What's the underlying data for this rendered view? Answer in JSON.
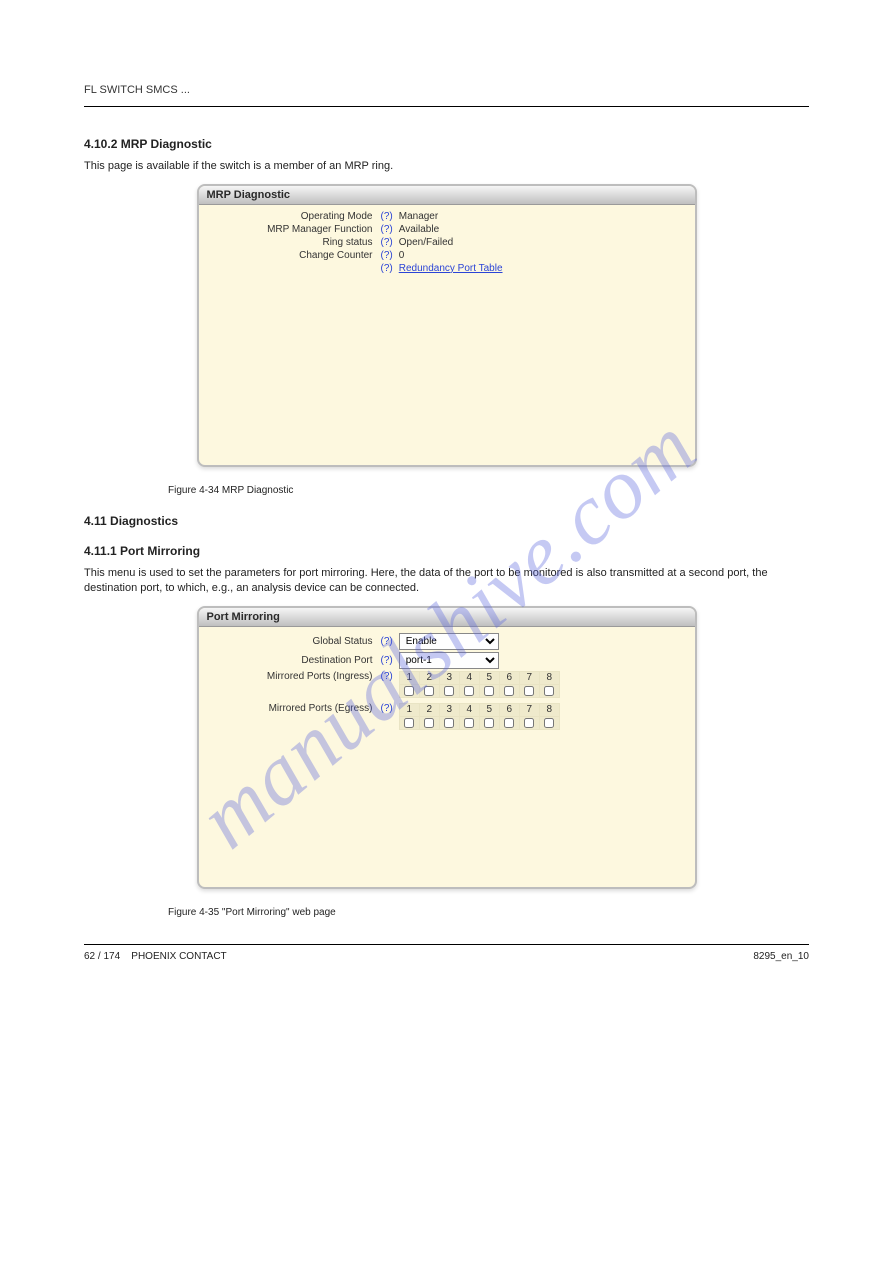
{
  "running_head": "FL SWITCH SMCS ...",
  "watermark": "manualshive.com",
  "section1": {
    "head": "4.10.2       MRP Diagnostic",
    "intro": "This page is available if the switch is a member of an MRP ring.",
    "panel_title": "MRP Diagnostic",
    "rows": {
      "op_mode_label": "Operating Mode",
      "op_mode_value": "Manager",
      "mgr_fn_label": "MRP Manager Function",
      "mgr_fn_value": "Available",
      "ring_label": "Ring status",
      "ring_value": "Open/Failed",
      "counter_label": "Change Counter",
      "counter_value": "0",
      "link_text": "Redundancy Port Table"
    },
    "help_marker": "(?)",
    "figcap": "Figure 4-34    MRP Diagnostic"
  },
  "section2": {
    "head": "4.11         Diagnostics",
    "sub_head": "4.11.1       Port Mirroring",
    "intro": "This menu is used to set the parameters for port mirroring. Here, the data of the port to be monitored is also transmitted at a second port, the destination port, to which, e.g., an analysis device can be connected.",
    "panel_title": "Port Mirroring",
    "rows": {
      "global_label": "Global Status",
      "global_value": "Enable",
      "dest_label": "Destination Port",
      "dest_value": "port-1",
      "ingress_label": "Mirrored Ports (Ingress)",
      "egress_label": "Mirrored Ports (Egress)"
    },
    "help_marker": "(?)",
    "ports": [
      "1",
      "2",
      "3",
      "4",
      "5",
      "6",
      "7",
      "8"
    ],
    "figcap": "Figure 4-35    \"Port Mirroring\" web page"
  },
  "footer": {
    "left": "62 / 174",
    "right": "PHOENIX CONTACT",
    "doc": "8295_en_10"
  }
}
